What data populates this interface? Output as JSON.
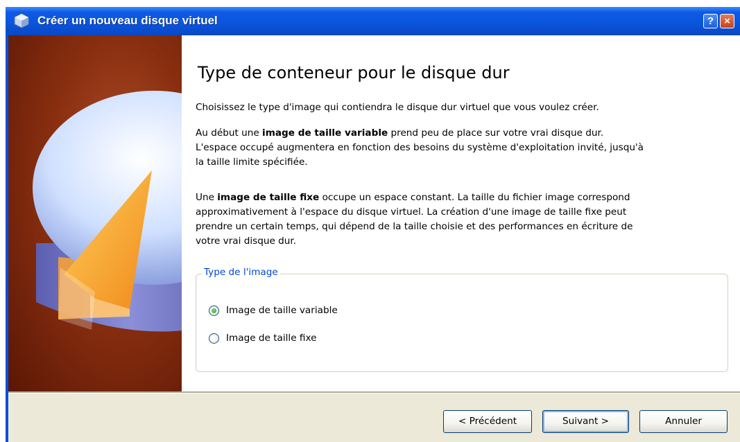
{
  "window": {
    "title": "Créer un nouveau disque virtuel",
    "help_button": "?",
    "close_button": "×"
  },
  "page": {
    "heading": "Type de conteneur pour le disque dur",
    "intro": "Choisissez le type d'image qui contiendra le disque dur virtuel que vous voulez créer.",
    "variable": {
      "prefix": "Au début une ",
      "bold": "image de taille variable",
      "text1": " prend peu de place sur votre vrai disque dur.",
      "text2": "L'espace occupé augmentera en fonction des besoins du système d'exploitation invité, jusqu'à",
      "text3": "la taille limite spécifiée."
    },
    "fixed": {
      "prefix": "Une ",
      "bold": "image de taille fixe",
      "text1": " occupe un espace constant. La taille du fichier image correspond",
      "text2": "approximativement à l'espace du disque virtuel. La création d'une image de taille fixe peut",
      "text3": "prendre un certain temps, qui dépend de la taille choisie et des performances en écriture de",
      "text4": "votre vrai disque dur."
    }
  },
  "image_type": {
    "legend": "Type de l'image",
    "options": [
      {
        "label": "Image de taille variable",
        "checked": true
      },
      {
        "label": "Image de taille fixe",
        "checked": false
      }
    ]
  },
  "buttons": {
    "previous": "< Précédent",
    "next": "Suivant >",
    "cancel": "Annuler"
  },
  "colors": {
    "titlebar": "#0a55dc",
    "group_legend": "#0046d5",
    "image_background": "#8a2f10"
  }
}
